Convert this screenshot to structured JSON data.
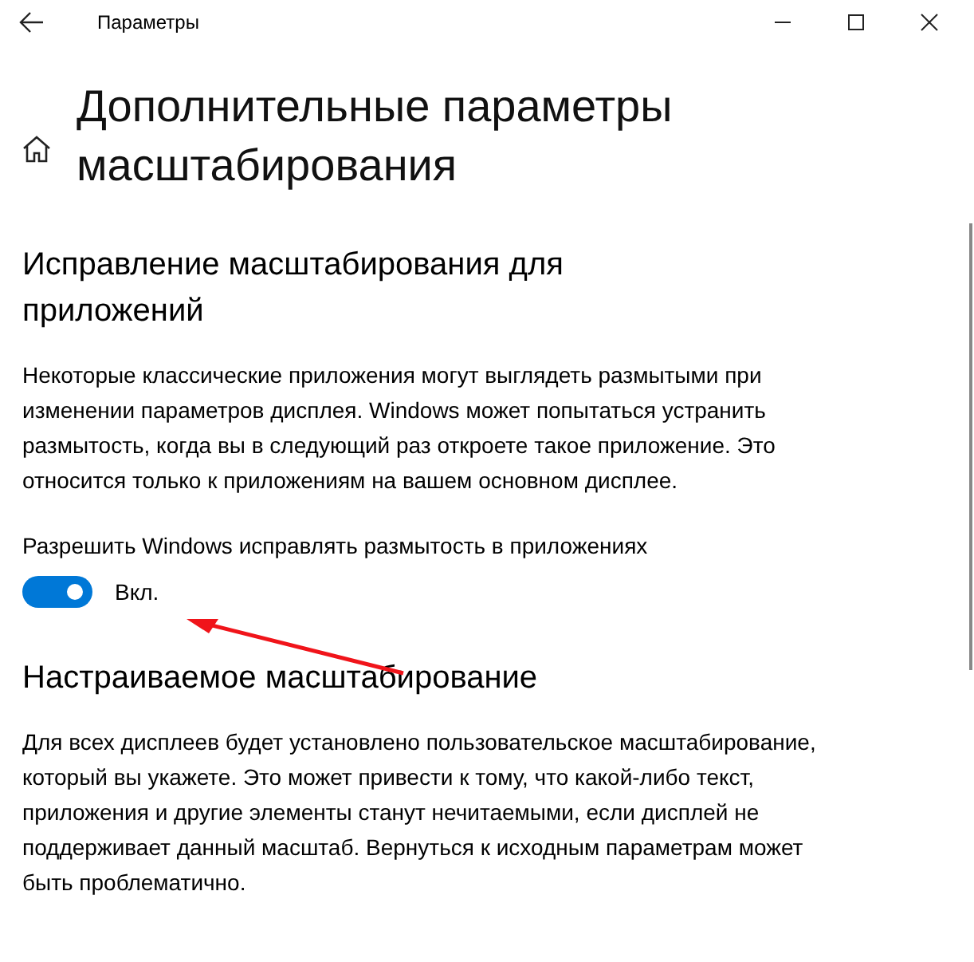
{
  "window": {
    "title": "Параметры"
  },
  "page": {
    "title": "Дополнительные параметры масштабирования"
  },
  "sections": [
    {
      "heading": "Исправление масштабирования для приложений",
      "text": "Некоторые классические приложения могут выглядеть размытыми при изменении параметров дисплея. Windows может попытаться устранить размытость, когда вы в следующий раз откроете такое приложение. Это относится только к приложениям на вашем основном дисплее.",
      "toggle": {
        "label": "Разрешить Windows исправлять размытость в приложениях",
        "on": true,
        "state_label": "Вкл."
      }
    },
    {
      "heading": "Настраиваемое масштабирование",
      "text": "Для всех дисплеев будет установлено пользовательское масштабирование, который вы укажете. Это может привести к тому, что какой-либо текст, приложения и другие элементы станут нечитаемыми, если дисплей не поддерживает данный масштаб. Вернуться к исходным параметрам может быть проблематично."
    }
  ]
}
